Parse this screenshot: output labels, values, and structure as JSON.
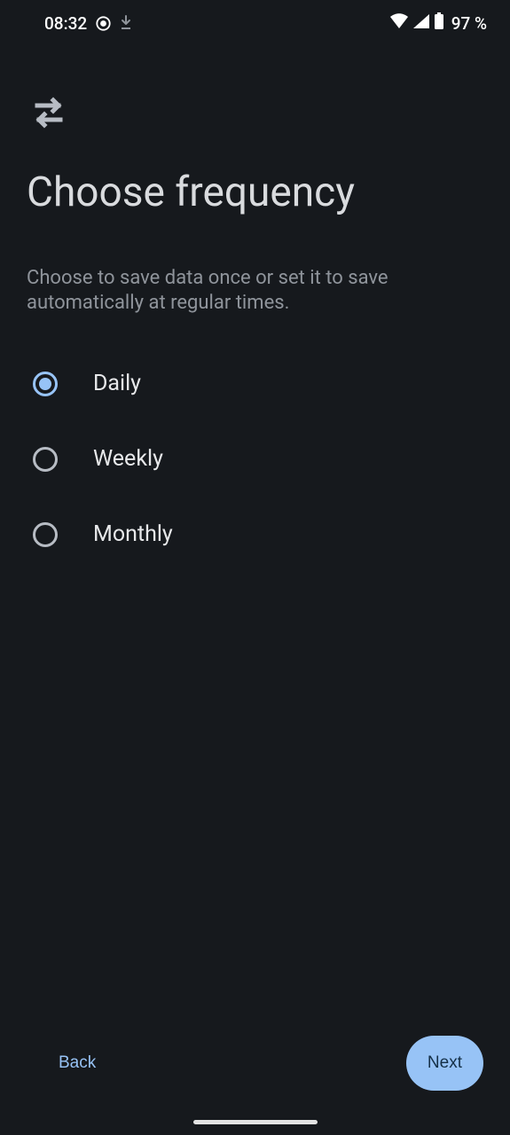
{
  "status": {
    "time": "08:32",
    "battery": "97 %"
  },
  "page": {
    "title": "Choose frequency",
    "description": "Choose to save data once or set it to save automatically at regular times."
  },
  "options": [
    {
      "label": "Daily",
      "selected": true
    },
    {
      "label": "Weekly",
      "selected": false
    },
    {
      "label": "Monthly",
      "selected": false
    }
  ],
  "buttons": {
    "back": "Back",
    "next": "Next"
  }
}
